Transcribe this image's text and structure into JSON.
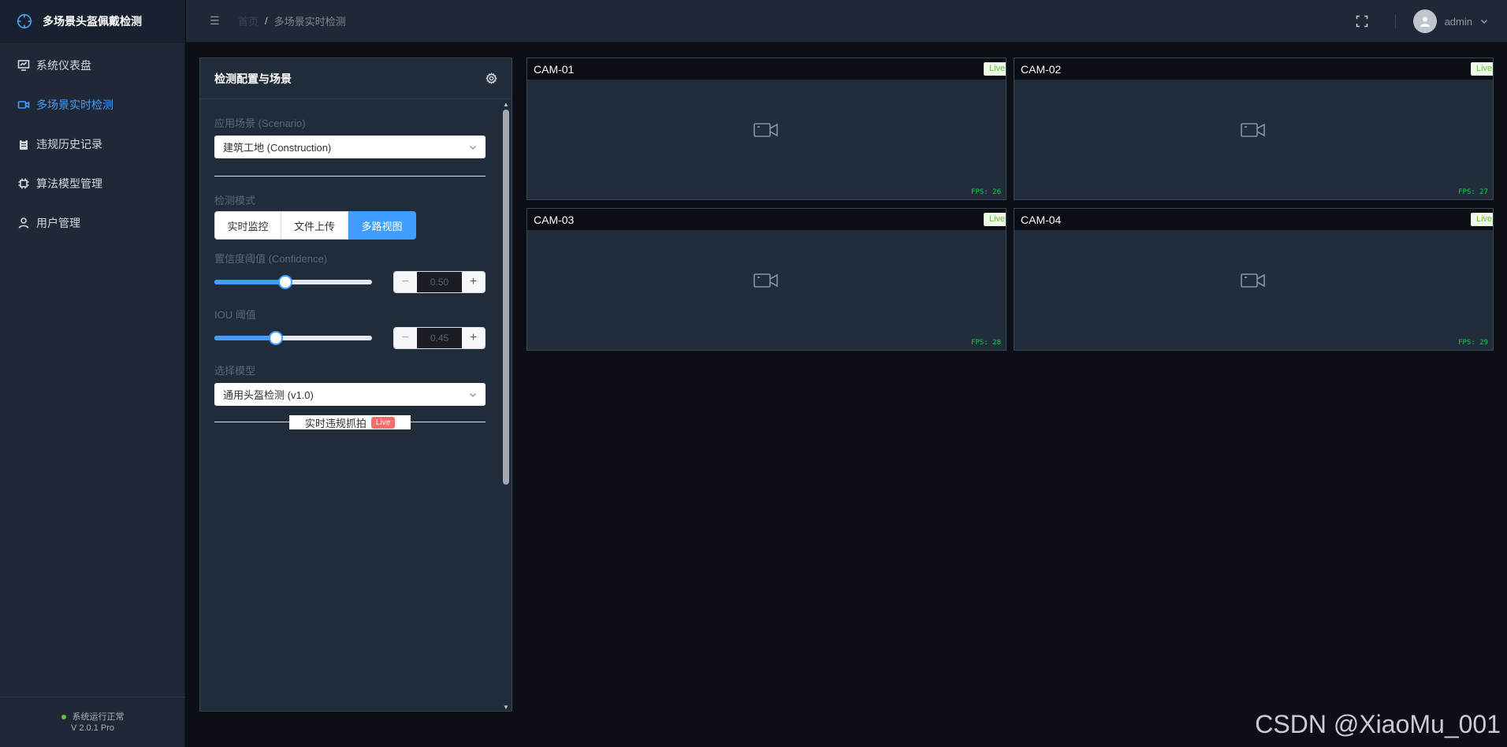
{
  "app": {
    "title": "多场景头盔佩戴检测"
  },
  "sidebar": {
    "items": [
      {
        "label": "系统仪表盘",
        "icon": "dashboard-icon"
      },
      {
        "label": "多场景实时检测",
        "icon": "video-camera-icon",
        "active": true
      },
      {
        "label": "违规历史记录",
        "icon": "clipboard-icon"
      },
      {
        "label": "算法模型管理",
        "icon": "chip-icon"
      },
      {
        "label": "用户管理",
        "icon": "user-icon"
      }
    ],
    "footer": {
      "status": "系统运行正常",
      "version": "V 2.0.1 Pro"
    }
  },
  "header": {
    "breadcrumb": {
      "home": "首页",
      "current": "多场景实时检测"
    },
    "username": "admin"
  },
  "config": {
    "title": "检测配置与场景",
    "scenario_label": "应用场景 (Scenario)",
    "scenario_value": "建筑工地 (Construction)",
    "mode_label": "检测模式",
    "modes": [
      "实时监控",
      "文件上传",
      "多路视图"
    ],
    "active_mode": "多路视图",
    "confidence_label": "置信度阈值 (Confidence)",
    "confidence_value": "0.50",
    "confidence_fraction": 0.45,
    "iou_label": "IOU 阈值",
    "iou_value": "0.45",
    "iou_fraction": 0.39,
    "model_label": "选择模型",
    "model_value": "通用头盔检测 (v1.0)",
    "capture_label": "实时违规抓拍",
    "capture_tag": "Live"
  },
  "cameras": [
    {
      "name": "CAM-01",
      "live": "Live",
      "fps": "FPS: 26"
    },
    {
      "name": "CAM-02",
      "live": "Live",
      "fps": "FPS: 27"
    },
    {
      "name": "CAM-03",
      "live": "Live",
      "fps": "FPS: 28"
    },
    {
      "name": "CAM-04",
      "live": "Live",
      "fps": "FPS: 29"
    }
  ],
  "watermark": "CSDN @XiaoMu_001",
  "colors": {
    "accent": "#409eff",
    "live_green": "#67c23a",
    "danger": "#f56c6c",
    "fps_green": "#00d74a"
  }
}
